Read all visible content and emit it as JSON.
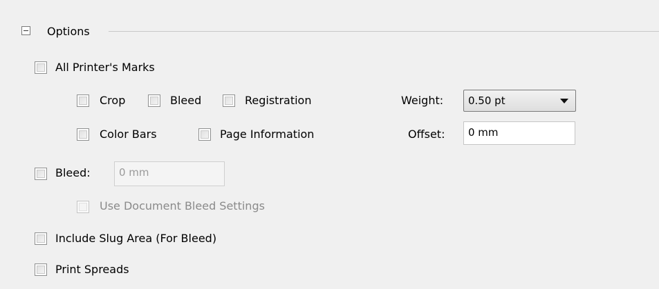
{
  "options_group": {
    "title": "Options",
    "all_printers_marks": {
      "label": "All Printer's Marks",
      "checked": false
    },
    "marks": {
      "crop": {
        "label": "Crop",
        "checked": false
      },
      "bleed": {
        "label": "Bleed",
        "checked": false
      },
      "registration": {
        "label": "Registration",
        "checked": false
      },
      "color_bars": {
        "label": "Color Bars",
        "checked": false
      },
      "page_information": {
        "label": "Page Information",
        "checked": false
      }
    },
    "weight": {
      "label": "Weight:",
      "value": "0.50 pt"
    },
    "offset": {
      "label": "Offset:",
      "value": "0 mm"
    },
    "bleed": {
      "label": "Bleed:",
      "value": "0 mm",
      "checked": false
    },
    "use_document_bleed": {
      "label": "Use Document Bleed Settings",
      "enabled": false
    },
    "include_slug": {
      "label": "Include Slug Area (For Bleed)",
      "checked": false
    },
    "print_spreads": {
      "label": "Print Spreads",
      "checked": false
    }
  }
}
